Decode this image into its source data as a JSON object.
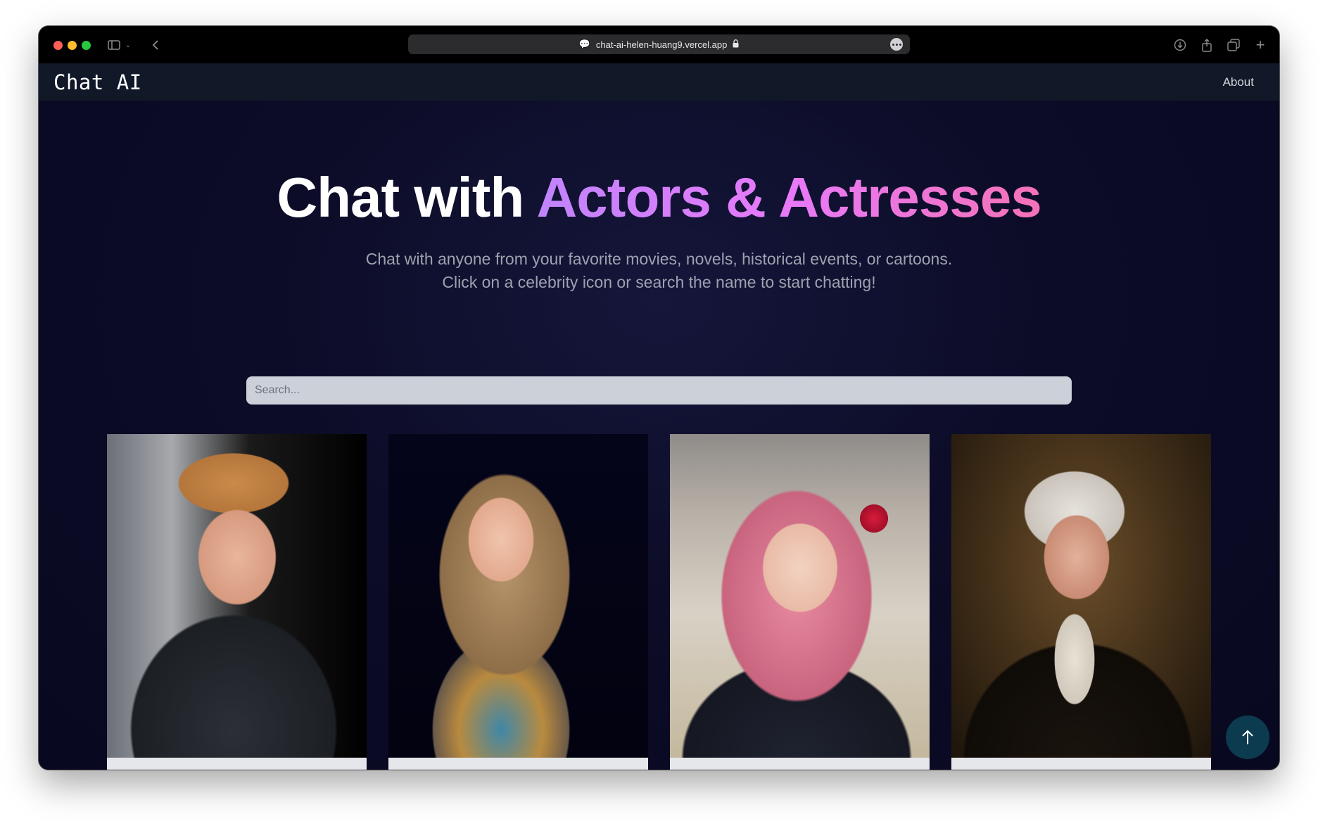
{
  "browser": {
    "url": "chat-ai-helen-huang9.vercel.app"
  },
  "navbar": {
    "brand": "Chat AI",
    "about_label": "About"
  },
  "hero": {
    "title_plain": "Chat with ",
    "title_highlight": "Actors & Actresses",
    "subtitle_line1": "Chat with anyone from your favorite movies, novels, historical events, or cartoons.",
    "subtitle_line2": "Click on a celebrity icon or search the name to start chatting!"
  },
  "search": {
    "placeholder": "Search..."
  },
  "cards": [
    {
      "name": ""
    },
    {
      "name": ""
    },
    {
      "name": ""
    },
    {
      "name": ""
    }
  ],
  "colors": {
    "title_gradient_start": "#c084fc",
    "title_gradient_end": "#f472b6",
    "navbar_bg": "#111827",
    "page_bg": "#0c0c28",
    "scroll_button_bg": "#0c3a4e"
  },
  "icons": {
    "scroll_top": "arrow-up-icon"
  }
}
